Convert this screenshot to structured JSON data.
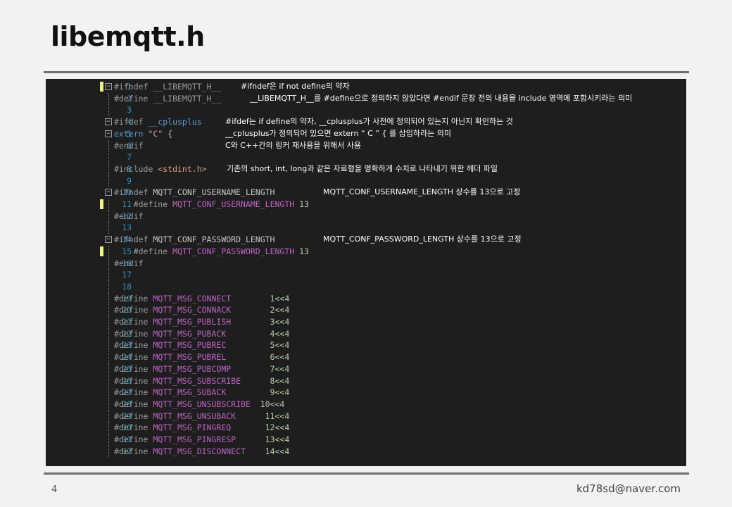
{
  "slide": {
    "title": "libemqtt.h",
    "page_number": "4",
    "author_email": "kd78sd@naver.com"
  },
  "colors": {
    "background": "#f2f2f2",
    "code_background": "#1e1e1e",
    "line_number": "#2b91af",
    "keyword": "#569cd6",
    "string": "#d69d85",
    "macro_name": "#bd63c5",
    "change_marker": "#eff283"
  },
  "lines": [
    {
      "n": "1",
      "mark": true,
      "fold": "−",
      "segments": [
        [
          "#ifndef ",
          "c"
        ],
        [
          "__LIBEMQTT_H__",
          "c"
        ]
      ]
    },
    {
      "n": "2",
      "mark": false,
      "fold": "",
      "segments": [
        [
          "#define ",
          "c"
        ],
        [
          "__LIBEMQTT_H__",
          "c"
        ]
      ]
    },
    {
      "n": "3",
      "mark": false,
      "fold": "",
      "segments": []
    },
    {
      "n": "4",
      "mark": false,
      "fold": "−",
      "segments": [
        [
          "#ifdef ",
          "c"
        ],
        [
          "__cplusplus",
          "kw"
        ]
      ]
    },
    {
      "n": "5",
      "mark": false,
      "fold": "−",
      "segments": [
        [
          "extern ",
          "kw"
        ],
        [
          "\"C\"",
          "str"
        ],
        [
          " {",
          "plain"
        ]
      ]
    },
    {
      "n": "6",
      "mark": false,
      "fold": "",
      "segments": [
        [
          "#endif",
          "c"
        ]
      ]
    },
    {
      "n": "7",
      "mark": false,
      "fold": "",
      "segments": []
    },
    {
      "n": "8",
      "mark": false,
      "fold": "",
      "segments": [
        [
          "#include ",
          "c"
        ],
        [
          "<stdint.h>",
          "str"
        ]
      ]
    },
    {
      "n": "9",
      "mark": false,
      "fold": "",
      "segments": []
    },
    {
      "n": "10",
      "mark": false,
      "fold": "−",
      "segments": [
        [
          "#ifndef ",
          "c"
        ],
        [
          "MQTT_CONF_USERNAME_LENGTH",
          "plain"
        ]
      ]
    },
    {
      "n": "11",
      "mark": true,
      "fold": "",
      "segments": [
        [
          "    #define ",
          "c"
        ],
        [
          "MQTT_CONF_USERNAME_LENGTH",
          "sym"
        ],
        [
          " 13",
          "num"
        ]
      ]
    },
    {
      "n": "12",
      "mark": false,
      "fold": "",
      "segments": [
        [
          "#endif",
          "c"
        ]
      ]
    },
    {
      "n": "13",
      "mark": false,
      "fold": "",
      "segments": []
    },
    {
      "n": "14",
      "mark": false,
      "fold": "−",
      "segments": [
        [
          "#ifndef ",
          "c"
        ],
        [
          "MQTT_CONF_PASSWORD_LENGTH",
          "plain"
        ]
      ]
    },
    {
      "n": "15",
      "mark": true,
      "fold": "",
      "segments": [
        [
          "    #define ",
          "c"
        ],
        [
          "MQTT_CONF_PASSWORD_LENGTH",
          "sym"
        ],
        [
          " 13",
          "num"
        ]
      ]
    },
    {
      "n": "16",
      "mark": false,
      "fold": "",
      "segments": [
        [
          "#endif",
          "c"
        ]
      ]
    },
    {
      "n": "17",
      "mark": false,
      "fold": "",
      "segments": []
    },
    {
      "n": "18",
      "mark": false,
      "fold": "",
      "segments": []
    },
    {
      "n": "19",
      "mark": false,
      "fold": "",
      "segments": [
        [
          "#define ",
          "c"
        ],
        [
          "MQTT_MSG_CONNECT",
          "sym"
        ],
        [
          "        1<<4",
          "num"
        ]
      ]
    },
    {
      "n": "20",
      "mark": false,
      "fold": "",
      "segments": [
        [
          "#define ",
          "c"
        ],
        [
          "MQTT_MSG_CONNACK",
          "sym"
        ],
        [
          "        2<<4",
          "num"
        ]
      ]
    },
    {
      "n": "21",
      "mark": false,
      "fold": "",
      "segments": [
        [
          "#define ",
          "c"
        ],
        [
          "MQTT_MSG_PUBLISH",
          "sym"
        ],
        [
          "        3<<4",
          "num"
        ]
      ]
    },
    {
      "n": "22",
      "mark": false,
      "fold": "",
      "segments": [
        [
          "#define ",
          "c"
        ],
        [
          "MQTT_MSG_PUBACK",
          "sym"
        ],
        [
          "         4<<4",
          "num"
        ]
      ]
    },
    {
      "n": "23",
      "mark": false,
      "fold": "",
      "segments": [
        [
          "#define ",
          "c"
        ],
        [
          "MQTT_MSG_PUBREC",
          "sym"
        ],
        [
          "         5<<4",
          "num"
        ]
      ]
    },
    {
      "n": "24",
      "mark": false,
      "fold": "",
      "segments": [
        [
          "#define ",
          "c"
        ],
        [
          "MQTT_MSG_PUBREL",
          "sym"
        ],
        [
          "         6<<4",
          "num"
        ]
      ]
    },
    {
      "n": "25",
      "mark": false,
      "fold": "",
      "segments": [
        [
          "#define ",
          "c"
        ],
        [
          "MQTT_MSG_PUBCOMP",
          "sym"
        ],
        [
          "        7<<4",
          "num"
        ]
      ]
    },
    {
      "n": "26",
      "mark": false,
      "fold": "",
      "segments": [
        [
          "#define ",
          "c"
        ],
        [
          "MQTT_MSG_SUBSCRIBE",
          "sym"
        ],
        [
          "      8<<4",
          "num"
        ]
      ]
    },
    {
      "n": "27",
      "mark": false,
      "fold": "",
      "segments": [
        [
          "#define ",
          "c"
        ],
        [
          "MQTT_MSG_SUBACK",
          "sym"
        ],
        [
          "         9<<4",
          "num"
        ]
      ]
    },
    {
      "n": "28",
      "mark": false,
      "fold": "",
      "segments": [
        [
          "#define ",
          "c"
        ],
        [
          "MQTT_MSG_UNSUBSCRIBE",
          "sym"
        ],
        [
          "  10<<4",
          "num"
        ]
      ]
    },
    {
      "n": "29",
      "mark": false,
      "fold": "",
      "segments": [
        [
          "#define ",
          "c"
        ],
        [
          "MQTT_MSG_UNSUBACK",
          "sym"
        ],
        [
          "      11<<4",
          "num"
        ]
      ]
    },
    {
      "n": "30",
      "mark": false,
      "fold": "",
      "segments": [
        [
          "#define ",
          "c"
        ],
        [
          "MQTT_MSG_PINGREQ",
          "sym"
        ],
        [
          "       12<<4",
          "num"
        ]
      ]
    },
    {
      "n": "31",
      "mark": false,
      "fold": "",
      "segments": [
        [
          "#define ",
          "c"
        ],
        [
          "MQTT_MSG_PINGRESP",
          "sym"
        ],
        [
          "      13<<4",
          "num"
        ]
      ]
    },
    {
      "n": "32",
      "mark": false,
      "fold": "",
      "segments": [
        [
          "#define ",
          "c"
        ],
        [
          "MQTT_MSG_DISCONNECT",
          "sym"
        ],
        [
          "    14<<4",
          "num"
        ]
      ]
    }
  ],
  "annotations": [
    {
      "line": 1,
      "text": "#ifndef은 if not define의 약자"
    },
    {
      "line": 2,
      "text": "__LIBEMQTT_H__를 #define으로 정의하지 않았다면 #endif 문장 전의 내용을 include 영역에 포함시키라는 의미"
    },
    {
      "line": 4,
      "text": "#ifdef는 if define의 약자, __cplusplus가 사전에 정의되어 있는지 아닌지 확인하는 것"
    },
    {
      "line": 5,
      "text": "__cplusplus가 정의되어 있으면 extern “ C ” { 를 삽입하라는 의미"
    },
    {
      "line": 6,
      "text": "C와 C++간의 링커 재사용을 위해서 사용"
    },
    {
      "line": 8,
      "text": "기존의 short, int, long과 같은 자료형을 명확하게 수치로 나타내기 위한 헤더 파일"
    },
    {
      "line": 10,
      "text": "MQTT_CONF_USERNAME_LENGTH  상수를 13으로 고정"
    },
    {
      "line": 14,
      "text": "MQTT_CONF_PASSWORD_LENGTH  상수를 13으로 고정"
    }
  ]
}
